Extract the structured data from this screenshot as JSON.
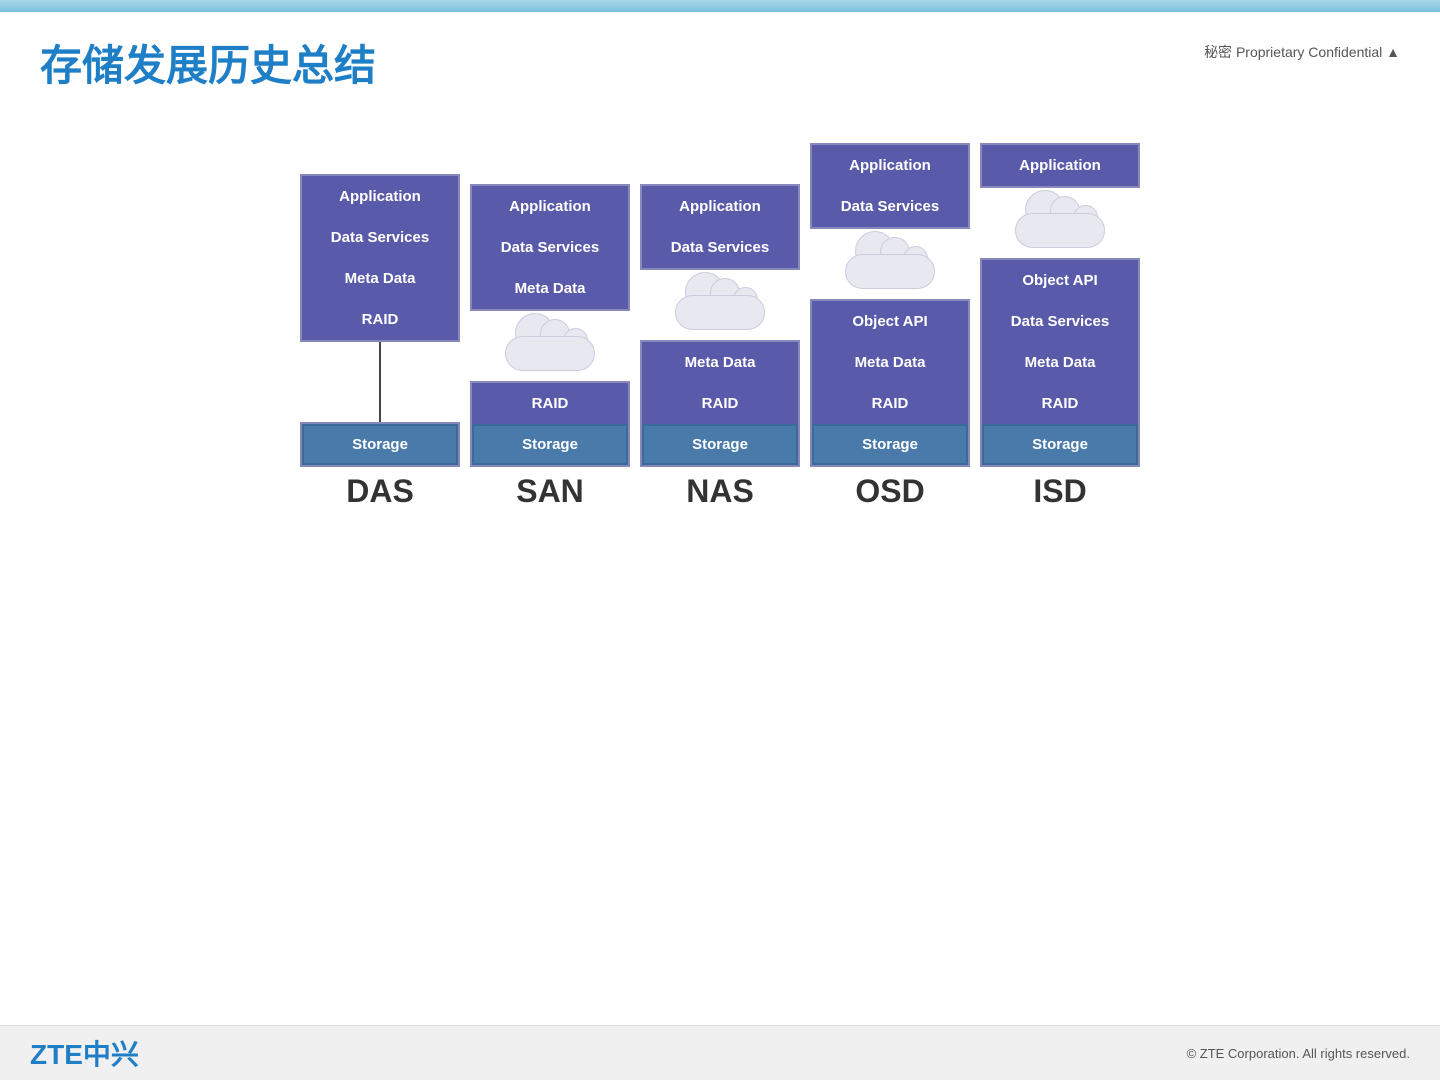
{
  "topbar": {},
  "header": {
    "title": "存储发展历史总结",
    "confidential": "秘密  Proprietary Confidential ▲"
  },
  "columns": [
    {
      "id": "das",
      "label": "DAS",
      "boxes": [
        {
          "text": "Application",
          "style": "purple"
        },
        {
          "text": "Data Services",
          "style": "purple"
        },
        {
          "text": "Meta Data",
          "style": "purple"
        },
        {
          "text": "RAID",
          "style": "purple"
        }
      ],
      "has_cloud": false,
      "cloud_position": null,
      "storage_box": {
        "text": "Storage",
        "style": "storage"
      },
      "connector_top_height": 0,
      "connector_bottom_height": 80
    },
    {
      "id": "san",
      "label": "SAN",
      "boxes": [
        {
          "text": "Application",
          "style": "purple"
        },
        {
          "text": "Data Services",
          "style": "purple"
        },
        {
          "text": "Meta Data",
          "style": "purple"
        }
      ],
      "has_cloud": true,
      "boxes_after_cloud": [
        {
          "text": "RAID",
          "style": "purple"
        }
      ],
      "storage_box": {
        "text": "Storage",
        "style": "storage"
      },
      "connector_top_height": 0,
      "connector_bottom_height": 0
    },
    {
      "id": "nas",
      "label": "NAS",
      "boxes": [
        {
          "text": "Application",
          "style": "purple"
        },
        {
          "text": "Data Services",
          "style": "purple"
        }
      ],
      "has_cloud": true,
      "boxes_after_cloud": [
        {
          "text": "Meta Data",
          "style": "purple"
        },
        {
          "text": "RAID",
          "style": "purple"
        }
      ],
      "storage_box": {
        "text": "Storage",
        "style": "storage"
      }
    },
    {
      "id": "osd",
      "label": "OSD",
      "boxes": [
        {
          "text": "Application",
          "style": "purple"
        },
        {
          "text": "Data Services",
          "style": "purple"
        }
      ],
      "has_cloud": true,
      "boxes_after_cloud": [
        {
          "text": "Object API",
          "style": "purple"
        },
        {
          "text": "Meta Data",
          "style": "purple"
        },
        {
          "text": "RAID",
          "style": "purple"
        }
      ],
      "storage_box": {
        "text": "Storage",
        "style": "storage"
      }
    },
    {
      "id": "isd",
      "label": "ISD",
      "boxes": [
        {
          "text": "Application",
          "style": "purple"
        }
      ],
      "has_cloud": true,
      "boxes_after_cloud": [
        {
          "text": "Object API",
          "style": "purple"
        },
        {
          "text": "Data Services",
          "style": "purple"
        },
        {
          "text": "Meta Data",
          "style": "purple"
        },
        {
          "text": "RAID",
          "style": "purple"
        }
      ],
      "storage_box": {
        "text": "Storage",
        "style": "storage"
      }
    }
  ],
  "footer": {
    "logo": "ZTE中兴",
    "copyright": "© ZTE Corporation. All rights reserved."
  }
}
